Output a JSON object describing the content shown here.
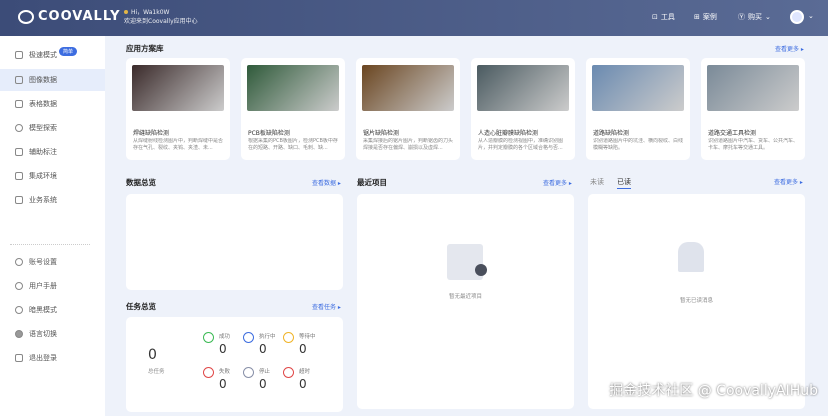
{
  "header": {
    "brand": "COOVALLY",
    "greeting": "Hi，Wa1k0W",
    "welcome": "欢迎来到Coovally应用中心",
    "nav": [
      {
        "label": "工具",
        "icon": "toolbox-icon"
      },
      {
        "label": "案例",
        "icon": "grid-icon"
      },
      {
        "label": "购买",
        "icon": "coin-icon"
      }
    ]
  },
  "sidebar": {
    "items": [
      {
        "label": "极速模式",
        "badge": "简单"
      },
      {
        "label": "图像数据"
      },
      {
        "label": "表格数据"
      },
      {
        "label": "模型探索"
      },
      {
        "label": "辅助标注"
      },
      {
        "label": "集成环境"
      },
      {
        "label": "业务系统"
      }
    ],
    "bottom": [
      {
        "label": "账号设置"
      },
      {
        "label": "用户手册"
      },
      {
        "label": "暗黑模式"
      },
      {
        "label": "语言切换"
      },
      {
        "label": "退出登录"
      }
    ]
  },
  "solutions": {
    "title": "应用方案库",
    "more": "查看更多 ▸",
    "cards": [
      {
        "title": "焊缝缺陷检测",
        "desc": "从焊缝射线检测图片中，判断焊缝中是否存在气孔、裂纹、夹钨、夹渣、未...",
        "color": "#3a2a2a"
      },
      {
        "title": "PCB板缺陷检测",
        "desc": "根据采集的PCB板图片，检测PCB板中存在的短路、开路、缺口、毛刺、缺...",
        "color": "#2f5a3a"
      },
      {
        "title": "锯片缺陷检测",
        "desc": "采集焊接后的锯片图片，判断锯齿的刀头焊接是否存在偏焊、崩损以及虚焊...",
        "color": "#6a4520"
      },
      {
        "title": "人造心脏瓣膜缺陷检测",
        "desc": "从人造瓣膜的检测视图中，准确识别图片，并判定瓣膜的各个区域合格与否...",
        "color": "#4a5a60"
      },
      {
        "title": "道路缺陷检测",
        "desc": "识别道路图片中的坑洼、横向裂纹、白线模糊等缺陷。",
        "color": "#6a8ab0"
      },
      {
        "title": "道路交通工具检测",
        "desc": "识别道路图片中汽车、货车、公共汽车、卡车、摩托车等交通工具。",
        "color": "#7a8a98"
      }
    ]
  },
  "data_overview": {
    "title": "数据总览",
    "more": "查看数据 ▸"
  },
  "recent": {
    "title": "最近项目",
    "more": "查看更多 ▸",
    "empty": "暂无最近项目"
  },
  "messages": {
    "tabs": [
      "未读",
      "已读"
    ],
    "more": "查看更多 ▸",
    "empty": "暂无已读消息"
  },
  "tasks": {
    "title": "任务总览",
    "more": "查看任务 ▸",
    "total": "0",
    "total_label": "总任务",
    "stats": [
      {
        "label": "成功",
        "value": "0",
        "color": "#3cba54"
      },
      {
        "label": "执行中",
        "value": "0",
        "color": "#3d6de0"
      },
      {
        "label": "等待中",
        "value": "0",
        "color": "#f0b429"
      },
      {
        "label": "失败",
        "value": "0",
        "color": "#e04848"
      },
      {
        "label": "停止",
        "value": "0",
        "color": "#8890a8"
      },
      {
        "label": "超时",
        "value": "0",
        "color": "#e04848"
      }
    ]
  },
  "watermark": "掘金技术社区 @ CoovallyAIHub"
}
